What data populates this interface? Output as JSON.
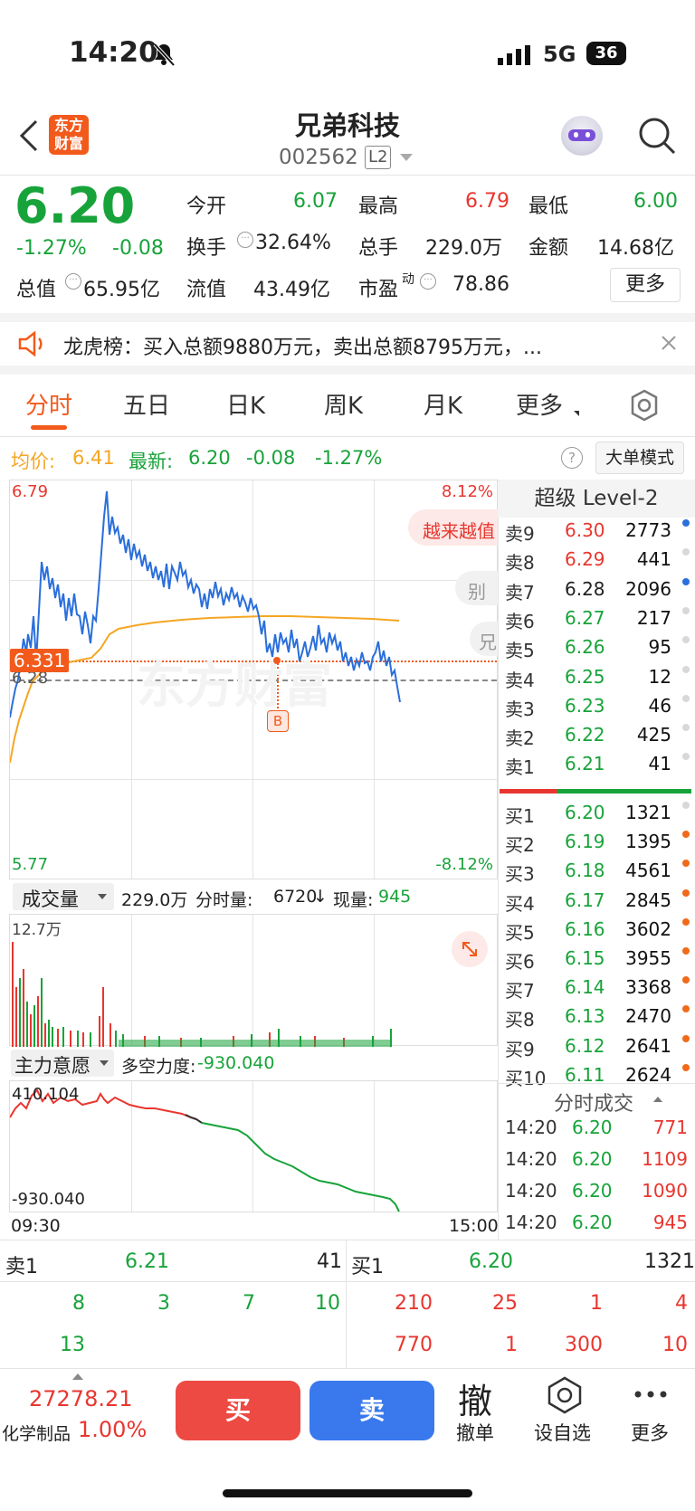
{
  "status_bar": {
    "time": "14:20",
    "network": "5G",
    "battery": "36"
  },
  "nav": {
    "logo_line1": "东方",
    "logo_line2": "财富",
    "stock_name": "兄弟科技",
    "stock_code": "002562",
    "level_badge": "L2"
  },
  "quote": {
    "price": "6.20",
    "change_pct": "-1.27%",
    "change": "-0.08",
    "open_label": "今开",
    "open": "6.07",
    "high_label": "最高",
    "high": "6.79",
    "low_label": "最低",
    "low": "6.00",
    "turnover_label": "换手",
    "turnover": "32.64%",
    "volume_label": "总手",
    "volume": "229.0万",
    "amount_label": "金额",
    "amount": "14.68亿",
    "mktcap_label": "总值",
    "mktcap": "65.95亿",
    "float_label": "流值",
    "float": "43.49亿",
    "pe_label": "市盈",
    "pe_sup": "动",
    "pe": "78.86",
    "more_button": "更多"
  },
  "notice": {
    "text": "龙虎榜：买入总额9880万元，卖出总额8795万元，..."
  },
  "tabs": [
    "分时",
    "五日",
    "日K",
    "周K",
    "月K",
    "更多"
  ],
  "legend": {
    "avg_label": "均价:",
    "avg_value": "6.41",
    "latest_label": "最新:",
    "latest_value": "6.20",
    "latest_change": "-0.08",
    "latest_pct": "-1.27%",
    "big_order_button": "大单模式"
  },
  "intraday": {
    "y_max": "6.79",
    "y_min": "5.77",
    "pct_max": "8.12%",
    "pct_min": "-8.12%",
    "prev_close": "6.28",
    "cursor_price": "6.331",
    "marker": "B",
    "promo_1": "越来越值",
    "promo_2": "别",
    "promo_3": "兄",
    "watermark": "东方财富"
  },
  "volume_panel": {
    "selector": "成交量",
    "total": "229.0万",
    "period_label": "分时量:",
    "period_value": "6720",
    "arrow": "↓",
    "now_label": "现量:",
    "now_value": "945",
    "max_label": "12.7万"
  },
  "flow_panel": {
    "selector": "主力意愿",
    "strength_label": "多空力度:",
    "strength_value": "-930.040",
    "top_label": "410.104",
    "bottom_label": "-930.040",
    "time_start": "09:30",
    "time_end": "15:00"
  },
  "orderbook": {
    "title": "超级 Level-2",
    "asks": [
      {
        "label": "卖9",
        "price": "6.30",
        "vol": "2773",
        "color": "#e8362f",
        "dot": "#2a6fdb"
      },
      {
        "label": "卖8",
        "price": "6.29",
        "vol": "441",
        "color": "#e8362f",
        "dot": "#d8d8d8"
      },
      {
        "label": "卖7",
        "price": "6.28",
        "vol": "2096",
        "color": "#222222",
        "dot": "#2a6fdb"
      },
      {
        "label": "卖6",
        "price": "6.27",
        "vol": "217",
        "color": "#18a33a",
        "dot": "#d8d8d8"
      },
      {
        "label": "卖5",
        "price": "6.26",
        "vol": "95",
        "color": "#18a33a",
        "dot": "#d8d8d8"
      },
      {
        "label": "卖4",
        "price": "6.25",
        "vol": "12",
        "color": "#18a33a",
        "dot": "#d8d8d8"
      },
      {
        "label": "卖3",
        "price": "6.23",
        "vol": "46",
        "color": "#18a33a",
        "dot": "#d8d8d8"
      },
      {
        "label": "卖2",
        "price": "6.22",
        "vol": "425",
        "color": "#18a33a",
        "dot": "#d8d8d8"
      },
      {
        "label": "卖1",
        "price": "6.21",
        "vol": "41",
        "color": "#18a33a",
        "dot": "#d8d8d8"
      }
    ],
    "bids": [
      {
        "label": "买1",
        "price": "6.20",
        "vol": "1321",
        "color": "#18a33a",
        "dot": "#d8d8d8"
      },
      {
        "label": "买2",
        "price": "6.19",
        "vol": "1395",
        "color": "#18a33a",
        "dot": "#f06a1a"
      },
      {
        "label": "买3",
        "price": "6.18",
        "vol": "4561",
        "color": "#18a33a",
        "dot": "#f06a1a"
      },
      {
        "label": "买4",
        "price": "6.17",
        "vol": "2845",
        "color": "#18a33a",
        "dot": "#f06a1a"
      },
      {
        "label": "买5",
        "price": "6.16",
        "vol": "3602",
        "color": "#18a33a",
        "dot": "#f06a1a"
      },
      {
        "label": "买6",
        "price": "6.15",
        "vol": "3955",
        "color": "#18a33a",
        "dot": "#f06a1a"
      },
      {
        "label": "买7",
        "price": "6.14",
        "vol": "3368",
        "color": "#18a33a",
        "dot": "#f06a1a"
      },
      {
        "label": "买8",
        "price": "6.13",
        "vol": "2470",
        "color": "#18a33a",
        "dot": "#f06a1a"
      },
      {
        "label": "买9",
        "price": "6.12",
        "vol": "2641",
        "color": "#18a33a",
        "dot": "#f06a1a"
      },
      {
        "label": "买10",
        "price": "6.11",
        "vol": "2624",
        "color": "#18a33a",
        "dot": "#f06a1a"
      }
    ]
  },
  "ticks": {
    "title": "分时成交",
    "rows": [
      {
        "time": "14:20",
        "price": "6.20",
        "vol": "771"
      },
      {
        "time": "14:20",
        "price": "6.20",
        "vol": "1109"
      },
      {
        "time": "14:20",
        "price": "6.20",
        "vol": "1090"
      },
      {
        "time": "14:20",
        "price": "6.20",
        "vol": "945"
      }
    ]
  },
  "queue": {
    "sell_label": "卖1",
    "sell_price": "6.21",
    "sell_vol": "41",
    "buy_label": "买1",
    "buy_price": "6.20",
    "buy_vol": "1321",
    "sell_orders_row1": [
      "8",
      "3",
      "7",
      "10"
    ],
    "sell_orders_row2": [
      "13"
    ],
    "buy_orders_row1": [
      "210",
      "25",
      "1",
      "4"
    ],
    "buy_orders_row2": [
      "770",
      "1",
      "300",
      "10"
    ]
  },
  "bottom": {
    "index_value": "27278.21",
    "index_name": "化学制品",
    "index_pct": "1.00%",
    "buy_button": "买",
    "sell_button": "卖",
    "cancel_icon_char": "撤",
    "cancel_label": "撤单",
    "watchlist_label": "设自选",
    "more_label": "更多"
  }
}
